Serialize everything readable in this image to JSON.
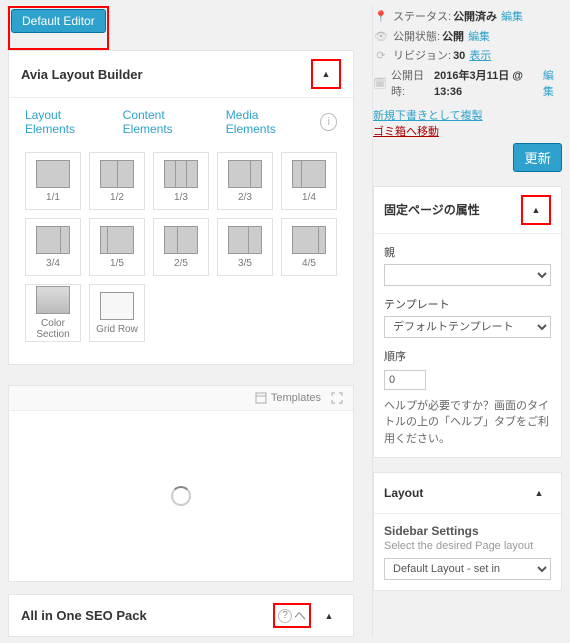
{
  "editor_btn": "Default Editor",
  "builder": {
    "title": "Avia Layout Builder",
    "tabs": [
      "Layout Elements",
      "Content Elements",
      "Media Elements"
    ],
    "cells": [
      "1/1",
      "1/2",
      "1/3",
      "2/3",
      "1/4",
      "3/4",
      "1/5",
      "2/5",
      "3/5",
      "4/5",
      "Color Section",
      "Grid Row"
    ]
  },
  "canvas": {
    "templates": "Templates"
  },
  "seo": {
    "title": "All in One SEO Pack",
    "help": "ヘ"
  },
  "publish": {
    "status_lbl": "ステータス:",
    "status_val": "公開済み",
    "edit": "編集",
    "vis_lbl": "公開状態:",
    "vis_val": "公開",
    "rev_lbl": "リビジョン:",
    "rev_val": "30",
    "rev_link": "表示",
    "date_lbl": "公開日時:",
    "date_val": "2016年3月11日 @ 13:36",
    "dup": "新規下書きとして複製",
    "trash": "ゴミ箱へ移動",
    "update": "更新"
  },
  "attrs": {
    "title": "固定ページの属性",
    "parent_lbl": "親",
    "parent_val": "",
    "tmpl_lbl": "テンプレート",
    "tmpl_val": "デフォルトテンプレート",
    "order_lbl": "順序",
    "order_val": "0",
    "help": "ヘルプが必要ですか？画面のタイトルの上の「ヘルプ」タブをご利用ください。"
  },
  "layout": {
    "title": "Layout",
    "sb_title": "Sidebar Settings",
    "sb_desc": "Select the desired Page layout",
    "sb_val": "Default Layout - set in"
  }
}
